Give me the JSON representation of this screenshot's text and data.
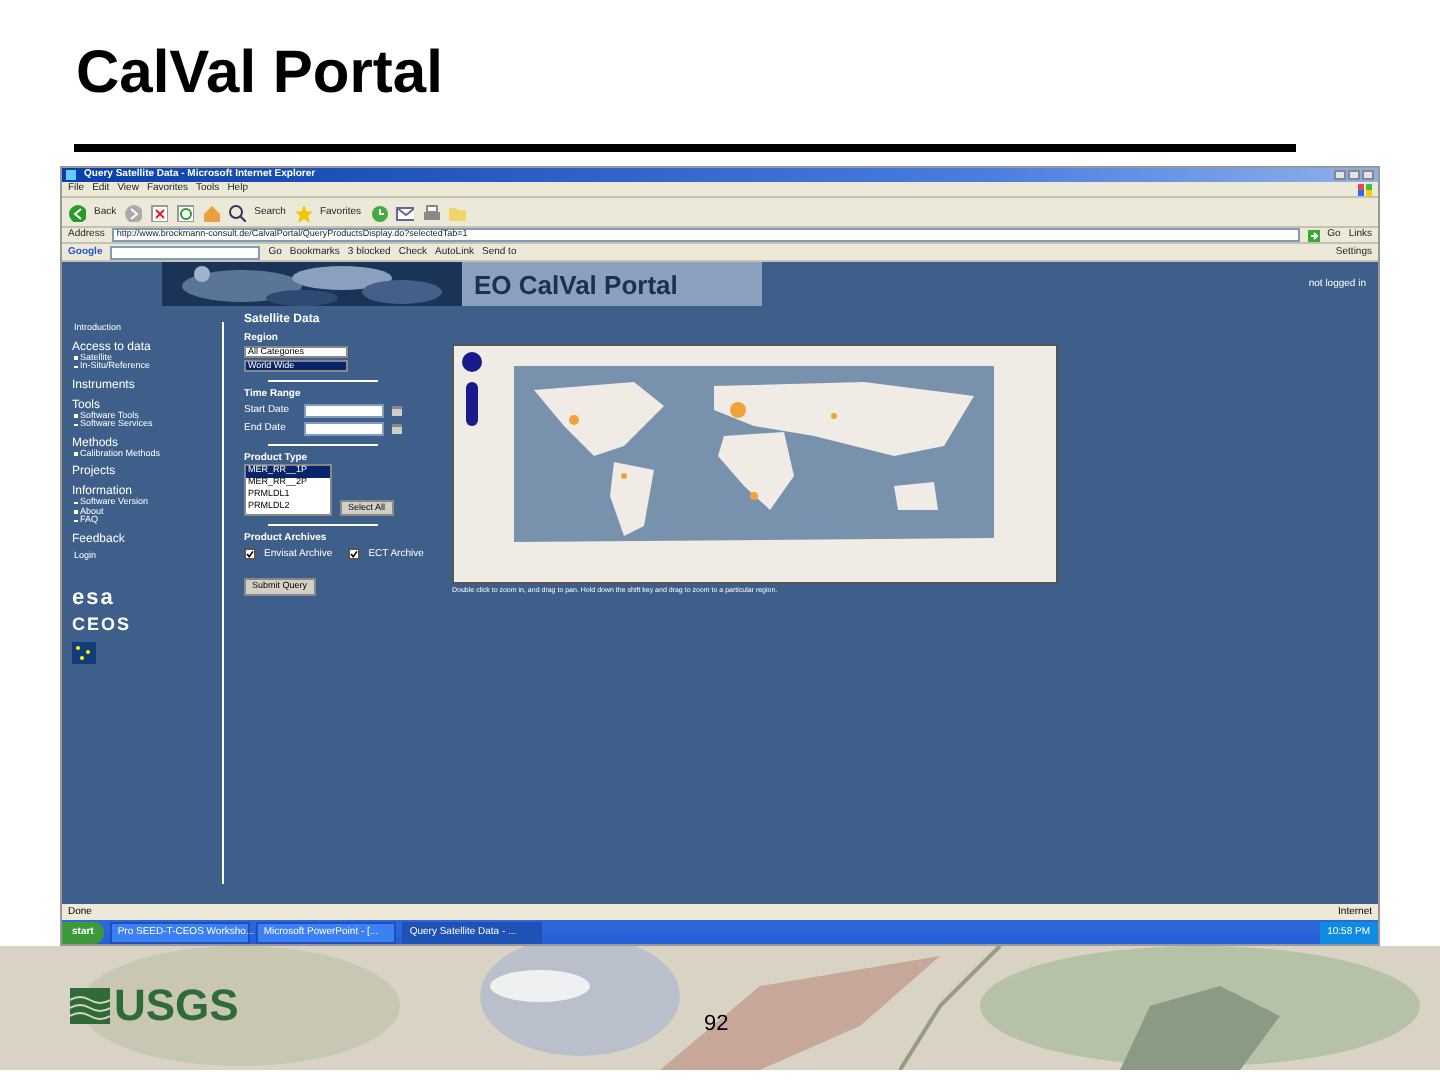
{
  "slide": {
    "title": "CalVal Portal",
    "logo_text": "USGS",
    "page_number": "92"
  },
  "browser": {
    "title": "Query Satellite Data - Microsoft Internet Explorer",
    "menu": [
      "File",
      "Edit",
      "View",
      "Favorites",
      "Tools",
      "Help"
    ],
    "toolbar": [
      {
        "kind": "back",
        "label": "Back"
      },
      {
        "kind": "forward"
      },
      {
        "kind": "stop"
      },
      {
        "kind": "refresh"
      },
      {
        "kind": "home"
      },
      {
        "kind": "search",
        "label": "Search"
      },
      {
        "kind": "favorites",
        "label": "Favorites"
      },
      {
        "kind": "history"
      },
      {
        "kind": "mail"
      },
      {
        "kind": "print"
      },
      {
        "kind": "folder"
      }
    ],
    "address_label": "Address",
    "url": "http://www.brockmann-consult.de/CalvalPortal/QueryProductsDisplay.do?selectedTab=1",
    "go": "Go",
    "links": "Links",
    "google_bar": {
      "logo": "Google",
      "go": "Go",
      "items": [
        "Bookmarks",
        "3 blocked",
        "Check",
        "AutoLink",
        "Send to"
      ],
      "settings": "Settings"
    },
    "status": "Done",
    "zone": "Internet"
  },
  "portal": {
    "title": "EO CalVal Portal",
    "login_status": "not logged in",
    "nav": [
      {
        "label": "Introduction",
        "kind": "link"
      },
      {
        "label": "Access to data",
        "kind": "heading",
        "children": [
          "Satellite",
          "In-Situ/Reference"
        ]
      },
      {
        "label": "Instruments",
        "kind": "heading"
      },
      {
        "label": "Tools",
        "kind": "heading",
        "children": [
          "Software Tools",
          "Software Services"
        ]
      },
      {
        "label": "Methods",
        "kind": "heading",
        "children": [
          "Calibration Methods"
        ]
      },
      {
        "label": "Projects",
        "kind": "heading"
      },
      {
        "label": "Information",
        "kind": "heading",
        "children": [
          "Software Version",
          "About",
          "FAQ"
        ]
      },
      {
        "label": "Feedback",
        "kind": "heading"
      },
      {
        "label": "Login",
        "kind": "link"
      }
    ],
    "partner_logos": [
      "esa",
      "CEOS"
    ],
    "form": {
      "title": "Satellite Data",
      "region_label": "Region",
      "region_selects": [
        {
          "value": "All Categories",
          "selected": false
        },
        {
          "value": "World Wide",
          "selected": true
        }
      ],
      "time_label": "Time Range",
      "date_fields": [
        "Start Date",
        "End Date"
      ],
      "product_label": "Product Type",
      "products": [
        {
          "value": "MER_RR__1P",
          "selected": true
        },
        {
          "value": "MER_RR__2P",
          "selected": false
        },
        {
          "value": "PRMLDL1",
          "selected": false
        },
        {
          "value": "PRMLDL2",
          "selected": false
        }
      ],
      "select_all": "Select All",
      "archives_label": "Product Archives",
      "archives": [
        {
          "label": "Envisat Archive",
          "checked": true
        },
        {
          "label": "ECT Archive",
          "checked": true
        }
      ],
      "submit": "Submit Query"
    },
    "map": {
      "caption": "Double click to zoom in, and drag to pan. Hold down the shift key and drag to zoom to a particular region."
    }
  },
  "taskbar": {
    "start": "start",
    "tasks": [
      {
        "label": "Pro SEED-T-CEOS Worksho...",
        "selected": false
      },
      {
        "label": "Microsoft PowerPoint - [...",
        "selected": false
      },
      {
        "label": "Query Satellite Data - ...",
        "selected": true
      }
    ],
    "clock": "10:58 PM"
  }
}
